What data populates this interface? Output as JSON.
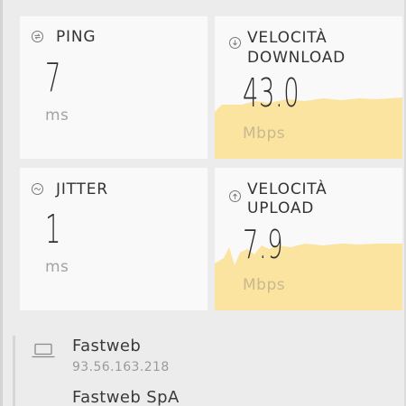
{
  "ping": {
    "label": "PING",
    "value": "7",
    "unit": "ms",
    "icon": "ping-icon"
  },
  "download": {
    "label_line1": "VELOCITÀ",
    "label_line2": "DOWNLOAD",
    "value": "43.0",
    "unit": "Mbps",
    "icon": "download-arrow-icon"
  },
  "jitter": {
    "label": "JITTER",
    "value": "1",
    "unit": "ms",
    "icon": "jitter-wave-icon"
  },
  "upload": {
    "label_line1": "VELOCITÀ",
    "label_line2": "UPLOAD",
    "value": "7.9",
    "unit": "Mbps",
    "icon": "upload-arrow-icon"
  },
  "network": {
    "icon": "laptop-icon",
    "provider": "Fastweb",
    "ip": "93.56.163.218",
    "organization": "Fastweb SpA"
  },
  "colors": {
    "speed_fill": "#fbe3a0",
    "card_bg": "#f9f9f9",
    "page_bg": "#ececec"
  }
}
